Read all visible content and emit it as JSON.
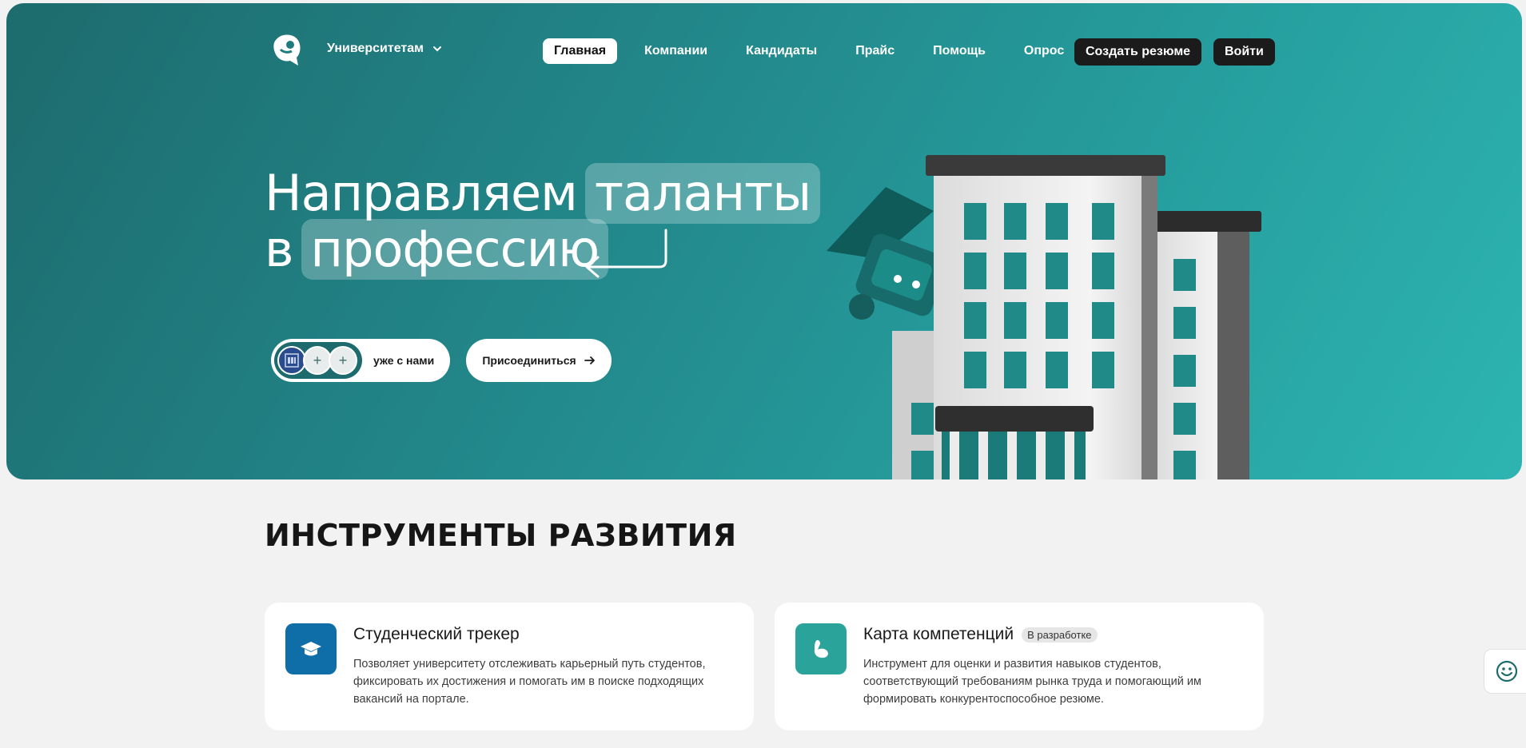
{
  "nav": {
    "univ_label": "Университетам",
    "links": [
      "Главная",
      "Компании",
      "Кандидаты",
      "Прайс",
      "Помощь",
      "Опрос"
    ],
    "resume_label": "Создать резюме",
    "login_label": "Войти"
  },
  "hero": {
    "line1_plain": "Направляем",
    "line1_chip": "таланты",
    "line2_plain": "в",
    "line2_chip": "профессию",
    "with_us_label": "уже с нами",
    "avatar_plus": "+",
    "join_label": "Присоединиться"
  },
  "section": {
    "title": "ИНСТРУМЕНТЫ РАЗВИТИЯ"
  },
  "cards": [
    {
      "title": "Студенческий трекер",
      "badge": "",
      "desc": "Позволяет университету отслеживать карьерный путь студентов, фиксировать их достижения и помогать им в поиске подходящих вакансий на портале.",
      "icon": "graduation-cap-icon"
    },
    {
      "title": "Карта компетенций",
      "badge": "В разработке",
      "desc": "Инструмент для оценки и развития навыков студентов, соответствующий требованиям рынка труда и помогающий им формировать конкурентоспособное резюме.",
      "icon": "flexed-arm-icon"
    }
  ],
  "colors": {
    "hero_start": "#1d6b6d",
    "hero_end": "#2db5b1",
    "card1_icon": "#0f6ea7",
    "card2_icon": "#2aa39b",
    "dark_button": "#1b1b1b"
  }
}
